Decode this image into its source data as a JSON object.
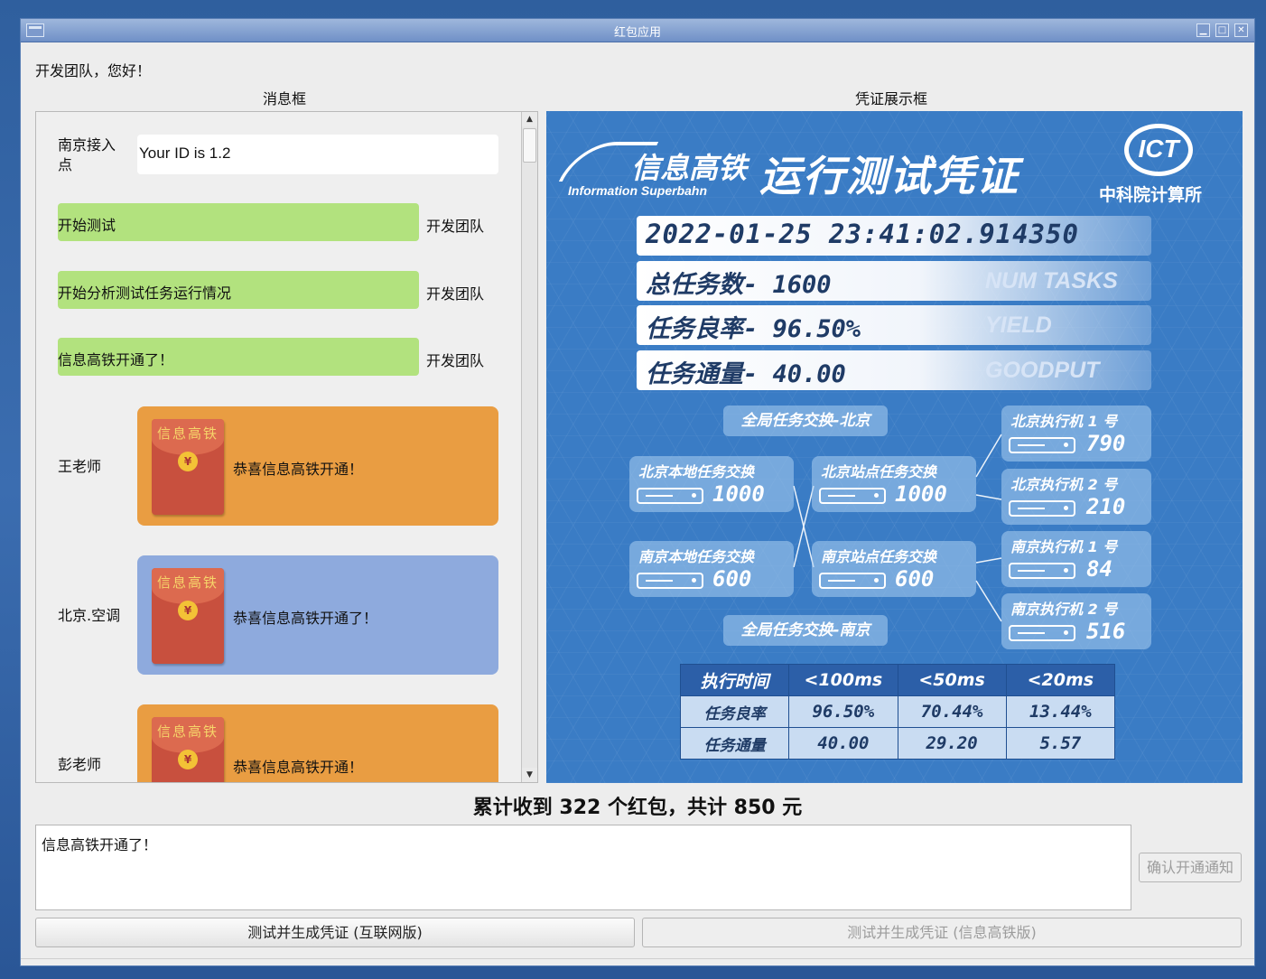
{
  "window": {
    "title": "红包应用",
    "controls": {
      "minimize": "▁",
      "maximize": "□",
      "close": "✕"
    }
  },
  "greeting": "开发团队，您好！",
  "labels": {
    "message_box": "消息框",
    "certificate_box": "凭证展示框"
  },
  "messages": {
    "id_row": {
      "sender": "南京接入点",
      "text": "Your ID is 1.2"
    },
    "green": [
      {
        "text": "开始测试",
        "sender": "开发团队"
      },
      {
        "text": "开始分析测试任务运行情况",
        "sender": "开发团队"
      },
      {
        "text": "信息高铁开通了！",
        "sender": "开发团队"
      }
    ],
    "red_packets": [
      {
        "sender": "王老师",
        "text": "恭喜信息高铁开通！",
        "color": "#e99d42",
        "envelope_title": "信息高铁",
        "coin": "¥"
      },
      {
        "sender": "北京.空调",
        "text": "恭喜信息高铁开通了！",
        "color": "#8eaadd",
        "envelope_title": "信息高铁",
        "coin": "¥"
      },
      {
        "sender": "彭老师",
        "text": "恭喜信息高铁开通！",
        "color": "#e99d42",
        "envelope_title": "信息高铁",
        "coin": "¥"
      }
    ],
    "scroll": {
      "up": "▲",
      "down": "▼"
    }
  },
  "certificate": {
    "brand": "信息高铁",
    "brand_sub": "Information Superbahn",
    "heading": "运行测试凭证",
    "logo_text": "ICT",
    "institute": "中科院计算所",
    "timestamp": "2022-01-25  23:41:02.914350",
    "stats": [
      {
        "label": "总任务数- 1600",
        "eng": "NUM TASKS"
      },
      {
        "label": "任务良率- 96.50%",
        "eng": "YIELD"
      },
      {
        "label": "任务通量- 40.00",
        "eng": "GOODPUT"
      }
    ],
    "topology": {
      "global_beijing": "全局任务交换-北京",
      "global_nanjing": "全局任务交换-南京",
      "switches": [
        {
          "label": "北京本地任务交换",
          "value": "1000"
        },
        {
          "label": "北京站点任务交换",
          "value": "1000"
        },
        {
          "label": "南京本地任务交换",
          "value": "600"
        },
        {
          "label": "南京站点任务交换",
          "value": "600"
        }
      ],
      "executors": [
        {
          "label": "北京执行机 1 号",
          "value": "790"
        },
        {
          "label": "北京执行机 2 号",
          "value": "210"
        },
        {
          "label": "南京执行机 1 号",
          "value": "84"
        },
        {
          "label": "南京执行机 2 号",
          "value": "516"
        }
      ]
    },
    "table": {
      "headers": [
        "执行时间",
        "<100ms",
        "<50ms",
        "<20ms"
      ],
      "rows": [
        [
          "任务良率",
          "96.50%",
          "70.44%",
          "13.44%"
        ],
        [
          "任务通量",
          "40.00",
          "29.20",
          "5.57"
        ]
      ]
    }
  },
  "summary": "累计收到 322 个红包，共计 850 元",
  "input": {
    "value": "信息高铁开通了！"
  },
  "buttons": {
    "confirm": "确认开通通知",
    "internet": "测试并生成凭证 (互联网版)",
    "superbahn": "测试并生成凭证 (信息高铁版)"
  }
}
